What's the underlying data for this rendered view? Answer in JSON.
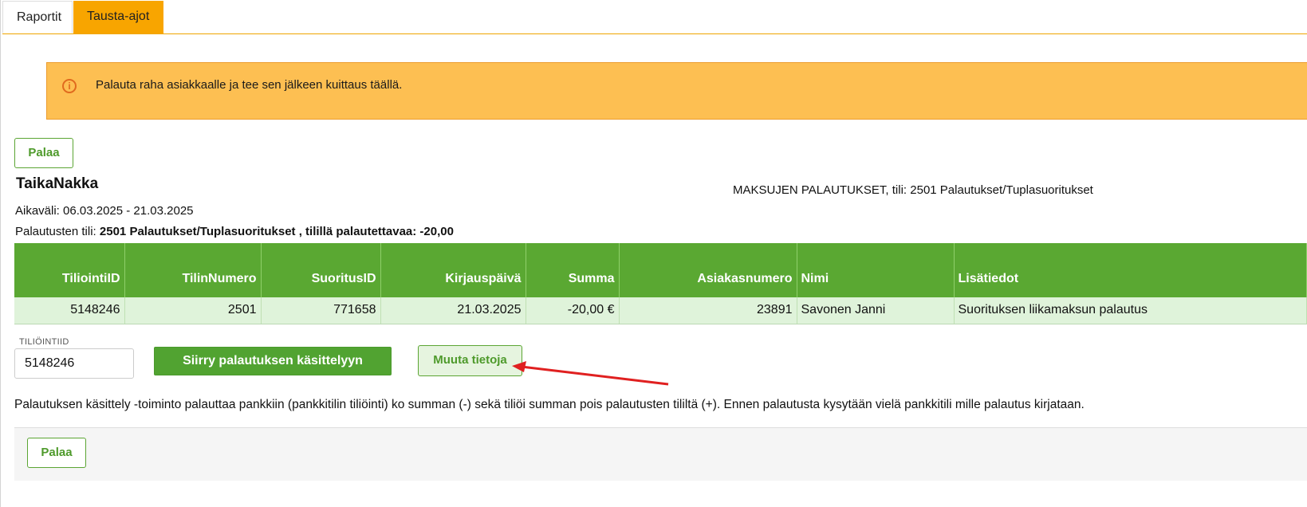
{
  "tabs": [
    {
      "label": "Raportit"
    },
    {
      "label": "Tausta-ajot"
    }
  ],
  "alert": {
    "icon": "info-circle-icon",
    "text": "Palauta raha asiakkaalle ja tee sen jälkeen kuittaus täällä."
  },
  "back_button": {
    "label": "Palaa"
  },
  "company": "TaikaNakka",
  "report_title": "MAKSUJEN PALAUTUKSET, tili: 2501 Palautukset/Tuplasuoritukset",
  "period": "Aikaväli: 06.03.2025 - 21.03.2025",
  "account_prefix": "Palautusten tili: ",
  "account_bold": "2501 Palautukset/Tuplasuoritukset , tilillä palautettavaa: -20,00",
  "table": {
    "headers": [
      "TiliointiID",
      "TilinNumero",
      "SuoritusID",
      "Kirjauspäivä",
      "Summa",
      "Asiakasnumero",
      "Nimi",
      "Lisätiedot"
    ],
    "rows": [
      [
        "5148246",
        "2501",
        "771658",
        "21.03.2025",
        "-20,00 €",
        "23891",
        "Savonen Janni",
        "Suorituksen liikamaksun palautus"
      ]
    ]
  },
  "form": {
    "field_label": "TILIÖINTIID",
    "field_value": "5148246",
    "process_button": "Siirry palautuksen käsittelyyn",
    "edit_button": "Muuta tietoja"
  },
  "description": "Palautuksen käsittely -toiminto palauttaa pankkiin (pankkitilin tiliöinti) ko summan (-) sekä tiliöi summan pois palautusten tililtä (+). Ennen palautusta kysytään vielä pankkitili mille palautus kirjataan.",
  "colors": {
    "accent_green": "#5aa832",
    "alert_orange": "#fdbf52",
    "tab_orange": "#f8a500",
    "annotation_arrow": "#e02020"
  }
}
